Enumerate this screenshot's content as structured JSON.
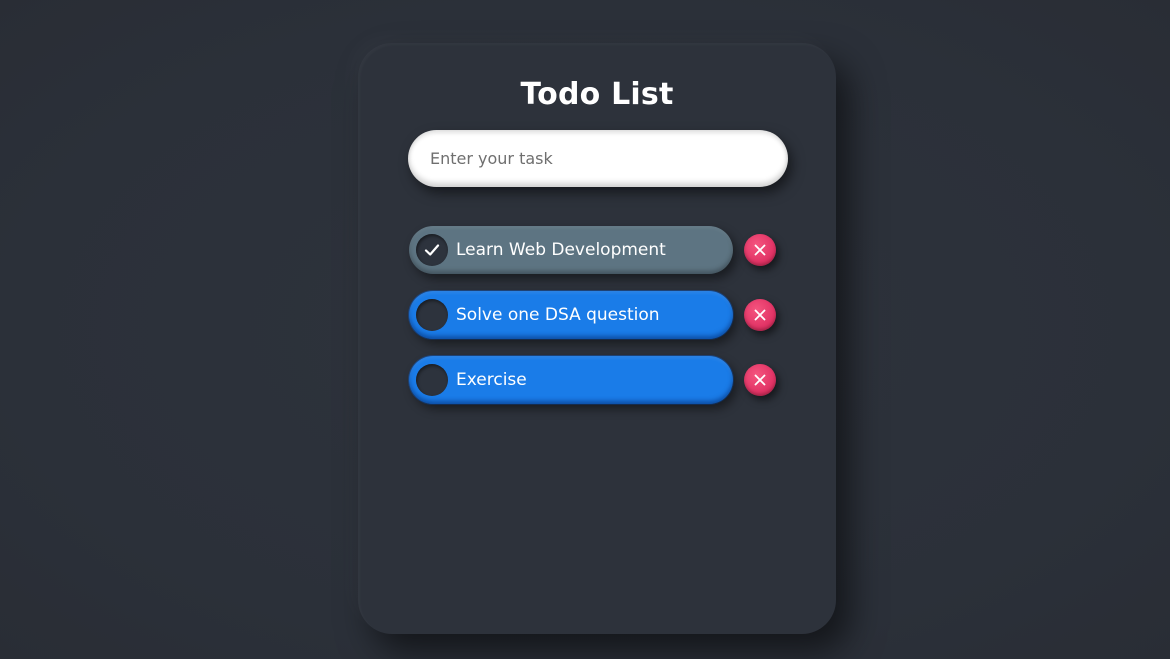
{
  "app": {
    "title": "Todo List"
  },
  "input": {
    "placeholder": "Enter your task",
    "value": ""
  },
  "tasks": [
    {
      "label": "Learn Web Development",
      "completed": true
    },
    {
      "label": "Solve one DSA question",
      "completed": false
    },
    {
      "label": "Exercise",
      "completed": false
    }
  ],
  "icons": {
    "check": "check-icon",
    "delete": "close-icon"
  },
  "colors": {
    "background": "#2c313a",
    "card": "#2d323b",
    "completed_task": "#5d7482",
    "pending_task": "#1a7ce8",
    "delete_button": "#e23466",
    "text": "#ffffff"
  }
}
